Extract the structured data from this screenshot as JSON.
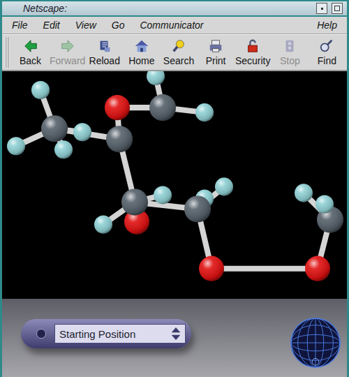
{
  "window": {
    "title": "Netscape:"
  },
  "menu": {
    "items": [
      "File",
      "Edit",
      "View",
      "Go",
      "Communicator"
    ],
    "help": "Help"
  },
  "toolbar": [
    {
      "label": "Back",
      "disabled": false
    },
    {
      "label": "Forward",
      "disabled": true
    },
    {
      "label": "Reload",
      "disabled": false
    },
    {
      "label": "Home",
      "disabled": false
    },
    {
      "label": "Search",
      "disabled": false
    },
    {
      "label": "Print",
      "disabled": false
    },
    {
      "label": "Security",
      "disabled": false
    },
    {
      "label": "Stop",
      "disabled": true
    },
    {
      "label": "Find",
      "disabled": false
    }
  ],
  "viewer": {
    "viewpoint": "Starting Position",
    "atoms": [
      {
        "kind": "hydrogen",
        "color": "#8fd0d4"
      },
      {
        "kind": "hydrogen",
        "color": "#8fd0d4"
      },
      {
        "kind": "hydrogen",
        "color": "#8fd0d4"
      },
      {
        "kind": "carbon",
        "color": "#55606a"
      },
      {
        "kind": "hydrogen",
        "color": "#8fd0d4"
      },
      {
        "kind": "hydrogen",
        "color": "#8fd0d4"
      },
      {
        "kind": "oxygen",
        "color": "#e01010"
      },
      {
        "kind": "carbon",
        "color": "#55606a"
      },
      {
        "kind": "carbon",
        "color": "#55606a"
      },
      {
        "kind": "hydrogen",
        "color": "#8fd0d4"
      },
      {
        "kind": "hydrogen",
        "color": "#8fd0d4"
      },
      {
        "kind": "hydrogen",
        "color": "#8fd0d4"
      },
      {
        "kind": "oxygen",
        "color": "#e01010"
      },
      {
        "kind": "carbon",
        "color": "#55606a"
      },
      {
        "kind": "hydrogen",
        "color": "#8fd0d4"
      },
      {
        "kind": "hydrogen",
        "color": "#8fd0d4"
      },
      {
        "kind": "hydrogen",
        "color": "#8fd0d4"
      },
      {
        "kind": "carbon",
        "color": "#55606a"
      },
      {
        "kind": "hydrogen",
        "color": "#8fd0d4"
      },
      {
        "kind": "oxygen",
        "color": "#e01010"
      },
      {
        "kind": "oxygen",
        "color": "#e01010"
      }
    ]
  }
}
